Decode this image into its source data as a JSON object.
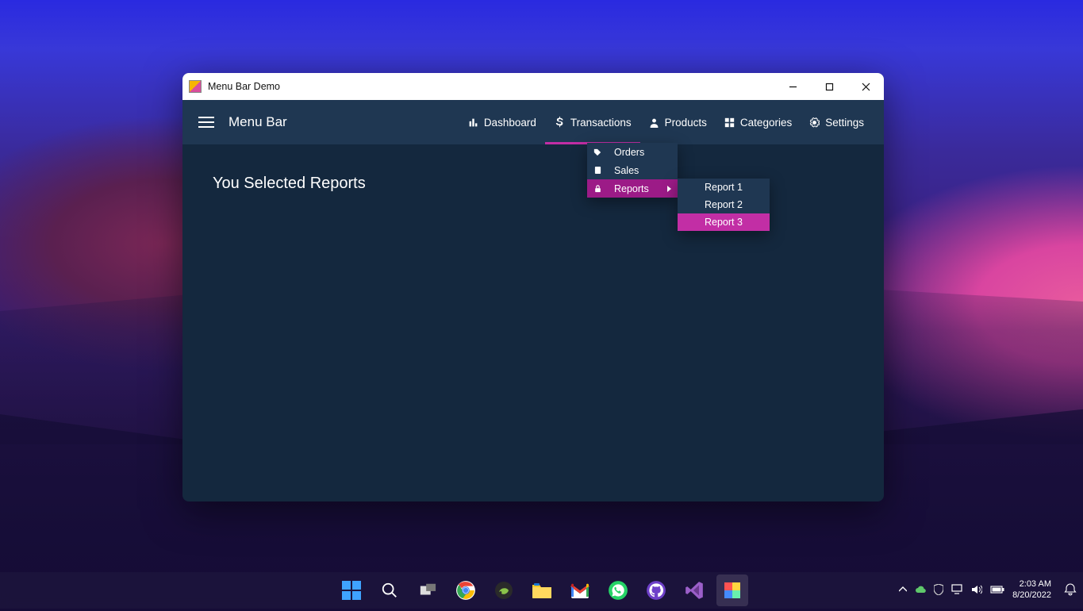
{
  "window": {
    "title": "Menu Bar Demo"
  },
  "menubar": {
    "title": "Menu Bar",
    "items": [
      {
        "label": "Dashboard"
      },
      {
        "label": "Transactions"
      },
      {
        "label": "Products"
      },
      {
        "label": "Categories"
      },
      {
        "label": "Settings"
      }
    ]
  },
  "dropdown": {
    "items": [
      {
        "label": "Orders"
      },
      {
        "label": "Sales"
      },
      {
        "label": "Reports"
      }
    ]
  },
  "submenu": {
    "items": [
      {
        "label": "Report 1"
      },
      {
        "label": "Report 2"
      },
      {
        "label": "Report 3"
      }
    ]
  },
  "content": {
    "message": "You Selected Reports"
  },
  "taskbar": {
    "time": "2:03 AM",
    "date": "8/20/2022"
  }
}
